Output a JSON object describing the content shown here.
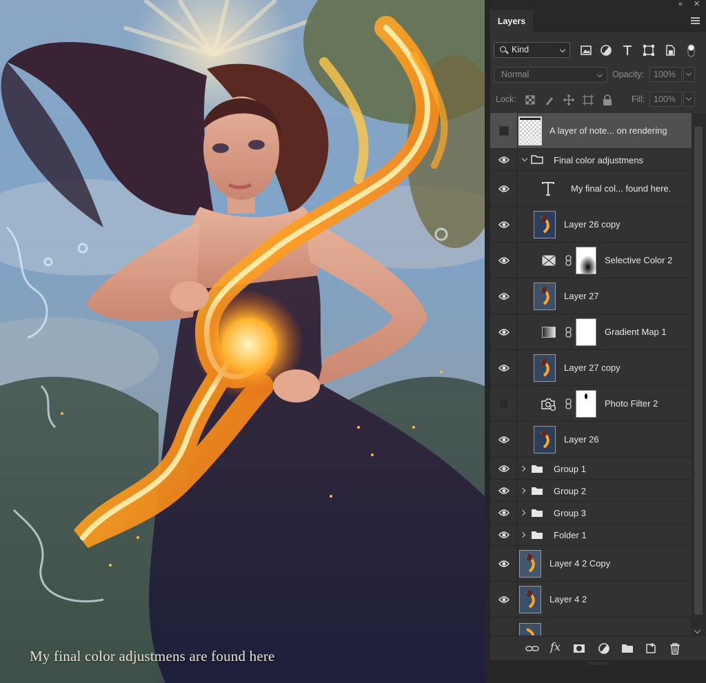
{
  "canvas": {
    "caption": "My final color adjustmens are found here"
  },
  "panel": {
    "collapse_glyph": "«",
    "close_glyph": "✕",
    "tab_title": "Layers",
    "filter": {
      "kind_label": "Kind",
      "icons": [
        "image-filter-icon",
        "adjustment-filter-icon",
        "type-filter-icon",
        "shape-filter-icon",
        "smart-object-filter-icon",
        "filter-toggle-icon"
      ]
    },
    "blend_mode": "Normal",
    "opacity_label": "Opacity:",
    "opacity_value": "100%",
    "lock_label": "Lock:",
    "fill_label": "Fill:",
    "fill_value": "100%"
  },
  "layers": [
    {
      "name": "A layer of note... on  rendering",
      "visible": false,
      "type": "note",
      "selected": true
    },
    {
      "name": "Final color adjustmens",
      "visible": true,
      "type": "group-open"
    },
    {
      "name": "My final col... found here.",
      "visible": true,
      "type": "text"
    },
    {
      "name": "Layer 26 copy",
      "visible": true,
      "type": "pixel"
    },
    {
      "name": "Selective Color 2",
      "visible": true,
      "type": "selective-color"
    },
    {
      "name": "Layer 27",
      "visible": true,
      "type": "pixel"
    },
    {
      "name": "Gradient Map 1",
      "visible": true,
      "type": "gradient-map"
    },
    {
      "name": "Layer 27 copy",
      "visible": true,
      "type": "pixel"
    },
    {
      "name": "Photo Filter 2",
      "visible": false,
      "type": "photo-filter"
    },
    {
      "name": "Layer 26",
      "visible": true,
      "type": "pixel"
    },
    {
      "name": "Group 1",
      "visible": true,
      "type": "group"
    },
    {
      "name": "Group 2",
      "visible": true,
      "type": "group"
    },
    {
      "name": "Group 3",
      "visible": true,
      "type": "group"
    },
    {
      "name": "Folder 1",
      "visible": true,
      "type": "group"
    },
    {
      "name": "Layer 4 2 Copy",
      "visible": true,
      "type": "pixel"
    },
    {
      "name": "Layer 4 2",
      "visible": true,
      "type": "pixel"
    }
  ],
  "footer": {
    "icons": [
      "link-layers-icon",
      "fx-icon",
      "add-mask-icon",
      "adjustment-layer-icon",
      "new-group-icon",
      "new-layer-icon",
      "delete-layer-icon"
    ],
    "fx_label": "fx"
  }
}
